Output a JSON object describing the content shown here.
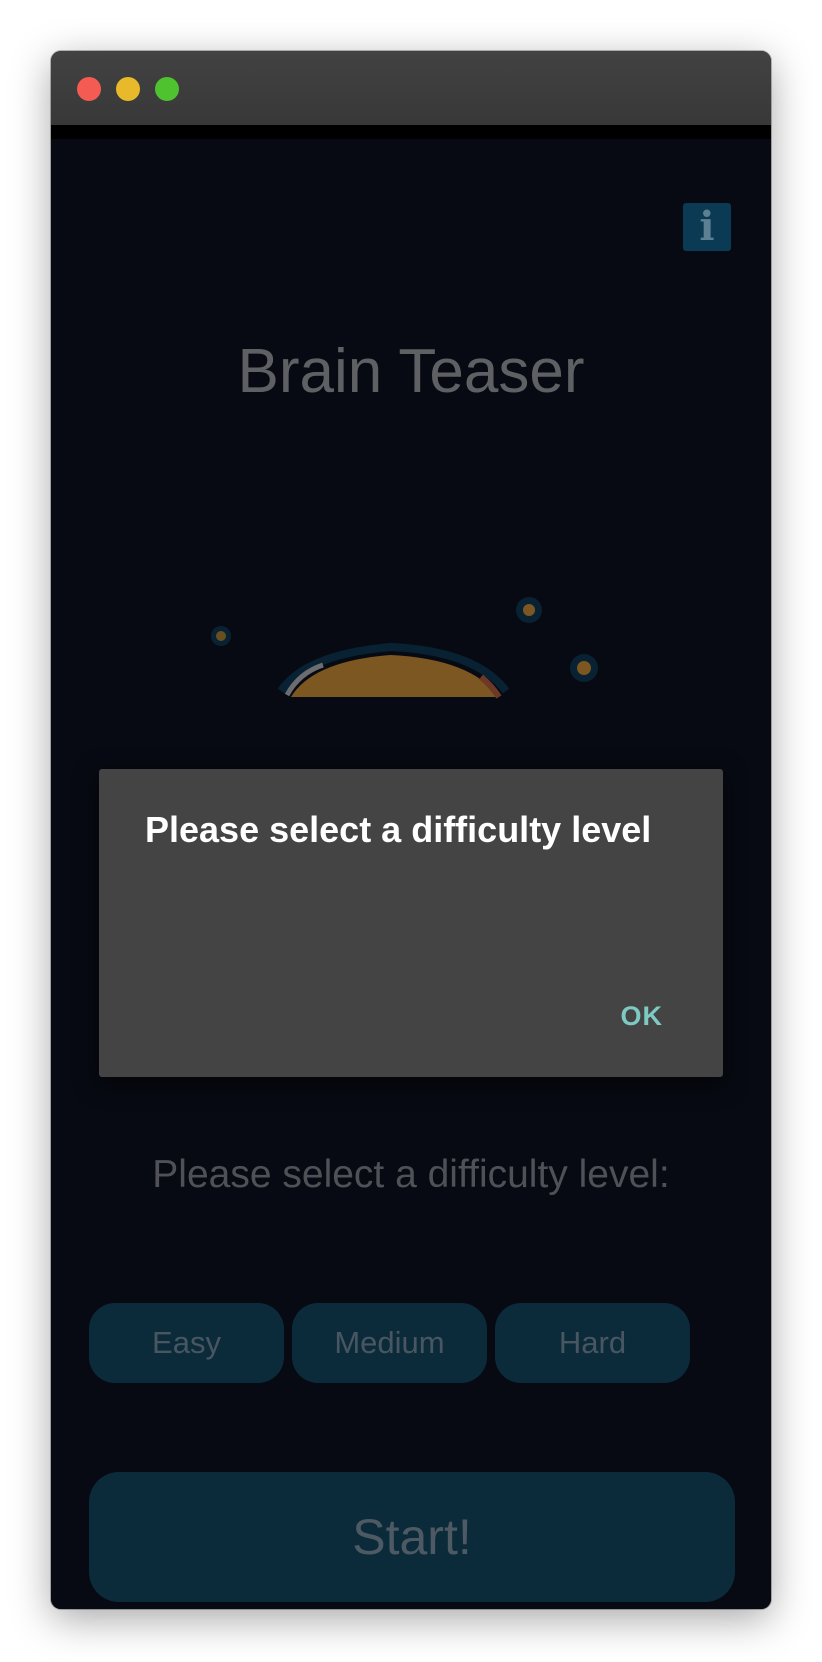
{
  "window": {
    "controls": {
      "close_icon": "close-icon",
      "minimize_icon": "minimize-icon",
      "zoom_icon": "zoom-icon"
    }
  },
  "header": {
    "info_icon": "info-icon",
    "info_glyph": "i"
  },
  "main": {
    "title": "Brain Teaser",
    "prompt": "Please select a difficulty level:",
    "difficulty_buttons": [
      {
        "label": "Easy"
      },
      {
        "label": "Medium"
      },
      {
        "label": "Hard"
      }
    ],
    "start_label": "Start!"
  },
  "dialog": {
    "title": "Please select a difficulty level",
    "ok_label": "OK"
  },
  "colors": {
    "background": "#070a12",
    "button_bg": "#0b2b3b",
    "dialog_bg": "#444444",
    "accent": "#7ecac2",
    "brain_orange": "#f0a331",
    "titlebar": "#3e3e3e"
  }
}
